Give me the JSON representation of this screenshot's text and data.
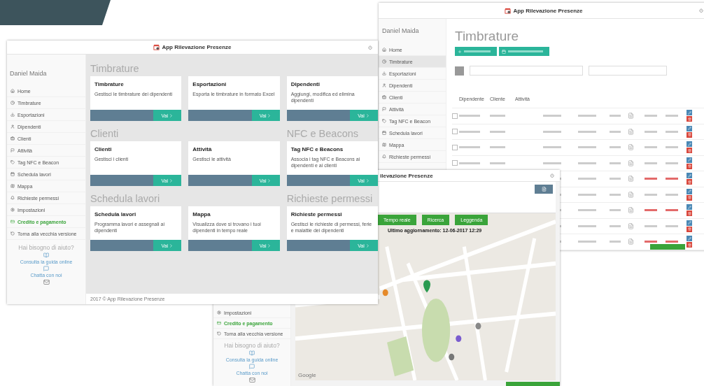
{
  "back_window": {
    "title": "App Rilevazione Presenze",
    "user": "Daniel Maida",
    "menu": [
      {
        "label": "Home",
        "selected": false
      },
      {
        "label": "Timbrature",
        "selected": true
      },
      {
        "label": "Esportazioni",
        "selected": false
      },
      {
        "label": "Dipendenti",
        "selected": false
      },
      {
        "label": "Clienti",
        "selected": false
      },
      {
        "label": "Attività",
        "selected": false
      },
      {
        "label": "Tag NFC e Beacon",
        "selected": false
      },
      {
        "label": "Schedula lavori",
        "selected": false
      },
      {
        "label": "Mappa",
        "selected": false
      },
      {
        "label": "Richieste permessi",
        "selected": false
      }
    ],
    "heading": "Timbrature",
    "columns": [
      "Dipendente",
      "Cliente",
      "Attività"
    ],
    "rows": [
      {
        "checked": false,
        "alert": false
      },
      {
        "checked": false,
        "alert": false
      },
      {
        "checked": false,
        "alert": false
      },
      {
        "checked": false,
        "alert": false
      },
      {
        "alert": true
      },
      {
        "alert": false
      },
      {
        "alert": true
      },
      {
        "alert": false
      },
      {
        "alert": true
      }
    ]
  },
  "map_window": {
    "title": "ilevazione Presenze",
    "menu": [
      {
        "label": "Impostazioni",
        "highlighted": false
      },
      {
        "label": "Credito e pagamento",
        "highlighted": true
      },
      {
        "label": "Torna alla vecchia versione",
        "highlighted": false
      }
    ],
    "help": {
      "title": "Hai bisogno di aiuto?",
      "links": [
        "Consulta la guida online",
        "Chatta con noi"
      ]
    },
    "map_buttons": [
      "Tempo reale",
      "Ricerca",
      "Leggenda"
    ],
    "updated": "Ultimo aggiornamento: 12-06-2017 12:29",
    "map_credit": "Google"
  },
  "front_window": {
    "title": "App Rilevazione Presenze",
    "user": "Daniel Maida",
    "menu": [
      {
        "label": "Home",
        "highlighted": false
      },
      {
        "label": "Timbrature",
        "highlighted": false
      },
      {
        "label": "Esportazioni",
        "highlighted": false
      },
      {
        "label": "Dipendenti",
        "highlighted": false
      },
      {
        "label": "Clienti",
        "highlighted": false
      },
      {
        "label": "Attività",
        "highlighted": false
      },
      {
        "label": "Tag NFC e Beacon",
        "highlighted": false
      },
      {
        "label": "Schedula lavori",
        "highlighted": false
      },
      {
        "label": "Mappa",
        "highlighted": false
      },
      {
        "label": "Richieste permessi",
        "highlighted": false
      },
      {
        "label": "Impostazioni",
        "highlighted": false
      },
      {
        "label": "Credito e pagamento",
        "highlighted": true
      },
      {
        "label": "Torna alla vecchia versione",
        "highlighted": false
      }
    ],
    "help": {
      "title": "Hai bisogno di aiuto?",
      "links": [
        "Consulta la guida online",
        "Chatta con noi"
      ]
    },
    "cards": [
      {
        "section": "Timbrature",
        "title": "Timbrature",
        "text": "Gestisci le timbrature dei dipendenti",
        "button": "Vai"
      },
      {
        "title": "Esportazioni",
        "text": "Esporta le timbrature in formato Excel",
        "button": "Vai"
      },
      {
        "title": "Dipendenti",
        "text": "Aggiungi, modifica ed elimina dipendenti",
        "button": "Vai"
      },
      {
        "section": "Clienti",
        "title": "Clienti",
        "text": "Gestisci i clienti",
        "button": "Vai"
      },
      {
        "title": "Attività",
        "text": "Gestisci le attività",
        "button": "Vai"
      },
      {
        "section": "NFC e Beacons",
        "title": "Tag NFC e Beacons",
        "text": "Associa i tag NFC e Beacons ai dipendenti e ai clienti",
        "button": "Vai"
      },
      {
        "section": "Schedula lavori",
        "title": "Schedula lavori",
        "text": "Programma lavori e assegnali ai dipendenti",
        "button": "Vai"
      },
      {
        "title": "Mappa",
        "text": "Visualizza dove si trovano i tuoi dipendenti in tempo reale",
        "button": "Vai"
      },
      {
        "section": "Richieste permessi",
        "title": "Richieste permessi",
        "text": "Gestisci le richieste di permessi, ferie e malattie dei dipendenti",
        "button": "Vai"
      }
    ],
    "footer": "2017 © App Rilevazione Presenze"
  }
}
